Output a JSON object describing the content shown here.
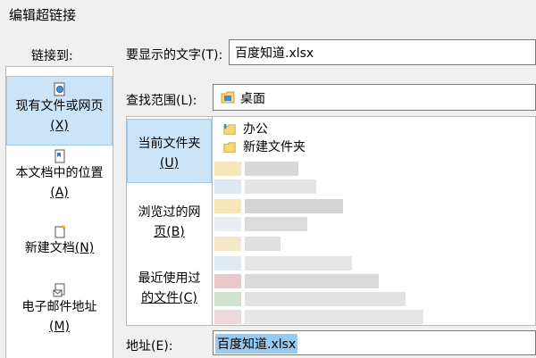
{
  "window": {
    "title": "编辑超链接"
  },
  "sidebar": {
    "header": "链接到:",
    "items": [
      {
        "label_a": "现有文件或网页",
        "label_b": "(X)",
        "icon": "web-page-icon"
      },
      {
        "label_a": "本文档中的位置",
        "label_b": "(A)",
        "icon": "bookmark-doc-icon"
      },
      {
        "label_a": "新建文档",
        "label_b": "(N)",
        "icon": "new-doc-icon"
      },
      {
        "label_a": "电子邮件地址",
        "label_b": "(M)",
        "icon": "email-icon"
      }
    ]
  },
  "display_text": {
    "label": "要显示的文字(T):",
    "value": "百度知道.xlsx"
  },
  "look_in": {
    "label": "查找范围(L):",
    "value": "桌面",
    "icon": "desktop-folder-icon"
  },
  "browse": {
    "items": [
      {
        "label_a": "当前文件夹",
        "label_b": "(U)"
      },
      {
        "label_a": "浏览过的网",
        "label_b": "页(B)"
      },
      {
        "label_a": "最近使用过",
        "label_b": "的文件(C)"
      }
    ]
  },
  "files": [
    {
      "name": "办公",
      "icon": "folder-icon"
    },
    {
      "name": "新建文件夹",
      "icon": "folder-icon"
    }
  ],
  "address": {
    "label": "地址(E):",
    "value": "百度知道.xlsx"
  },
  "colors": {
    "accent": "#cce4f7",
    "accent_border": "#99c9ef",
    "folder": "#f8d775"
  }
}
